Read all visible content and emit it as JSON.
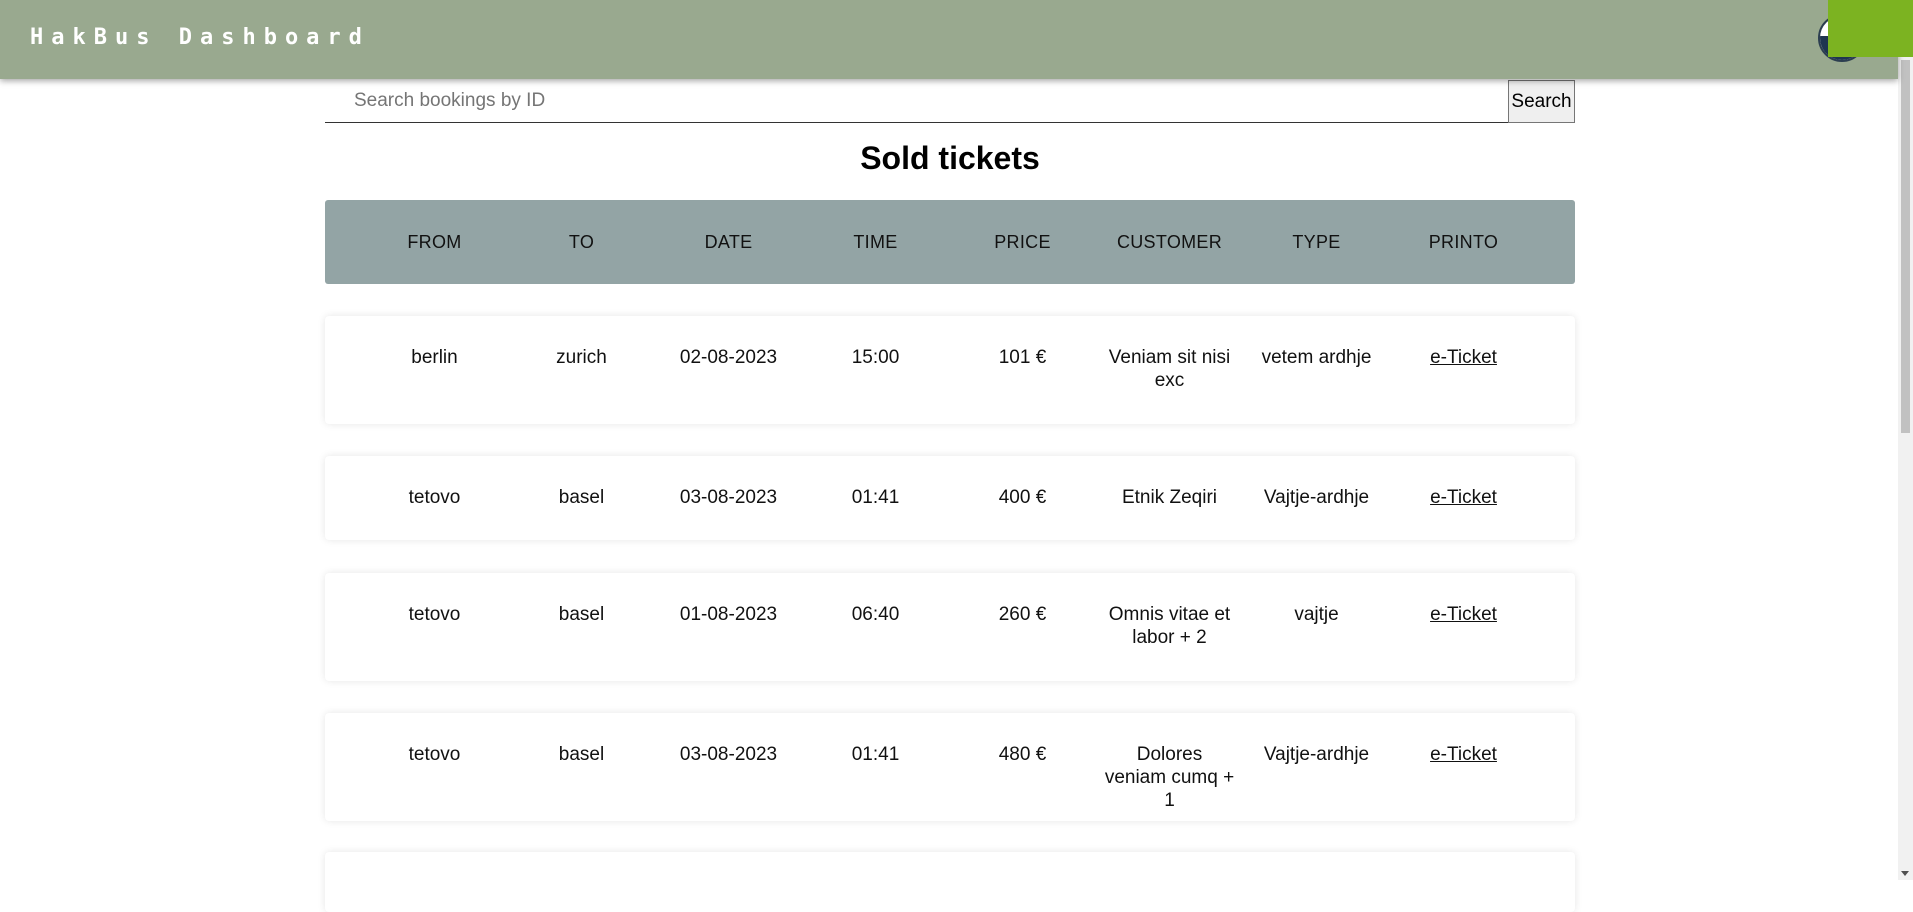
{
  "header": {
    "brand": "HakBus Dashboard"
  },
  "search": {
    "placeholder": "Search bookings by ID",
    "value": "",
    "button_label": "Search"
  },
  "page_title": "Sold tickets",
  "table": {
    "columns": [
      "FROM",
      "TO",
      "DATE",
      "TIME",
      "PRICE",
      "CUSTOMER",
      "TYPE",
      "PRINTO"
    ],
    "rows": [
      {
        "from": "berlin",
        "to": "zurich",
        "date": "02-08-2023",
        "time": "15:00",
        "price": "101 €",
        "customer": "Veniam sit nisi exc",
        "type": "vetem ardhje",
        "print": "e-Ticket"
      },
      {
        "from": "tetovo",
        "to": "basel",
        "date": "03-08-2023",
        "time": "01:41",
        "price": "400 €",
        "customer": "Etnik Zeqiri",
        "type": "Vajtje-ardhje",
        "print": "e-Ticket"
      },
      {
        "from": "tetovo",
        "to": "basel",
        "date": "01-08-2023",
        "time": "06:40",
        "price": "260 €",
        "customer": "Omnis vitae et labor + 2",
        "type": "vajtje",
        "print": "e-Ticket"
      },
      {
        "from": "tetovo",
        "to": "basel",
        "date": "03-08-2023",
        "time": "01:41",
        "price": "480 €",
        "customer": "Dolores veniam cumq + 1",
        "type": "Vajtje-ardhje",
        "print": "e-Ticket"
      }
    ]
  },
  "colors": {
    "header_bg": "#99a98f",
    "table_head_bg": "#93a4a5",
    "corner_accent": "#7cb321"
  }
}
